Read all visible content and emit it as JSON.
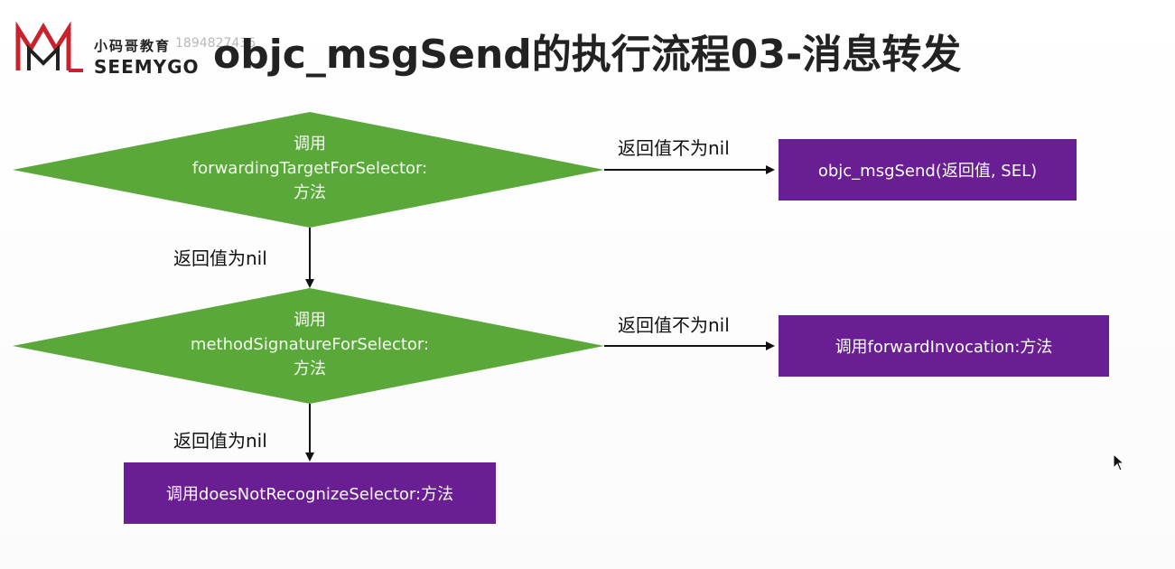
{
  "logo": {
    "chinese_text": "小码哥教育",
    "english_text": "SEEMYGO",
    "watermark": "1894827436"
  },
  "title": "objc_msgSend的执行流程03-消息转发",
  "diagram": {
    "decisions": [
      {
        "line1": "调用",
        "line2": "forwardingTargetForSelector:",
        "line3": "方法"
      },
      {
        "line1": "调用",
        "line2": "methodSignatureForSelector:",
        "line3": "方法"
      }
    ],
    "boxes": {
      "msgsend": "objc_msgSend(返回值, SEL)",
      "forward_invocation": "调用forwardInvocation:方法",
      "does_not_recognize": "调用doesNotRecognizeSelector:方法"
    },
    "edge_labels": {
      "not_nil_1": "返回值不为nil",
      "is_nil_1": "返回值为nil",
      "not_nil_2": "返回值不为nil",
      "is_nil_2": "返回值为nil"
    }
  },
  "colors": {
    "decision_fill": "#5aa83a",
    "box_fill": "#6a1e93",
    "arrow": "#111111"
  }
}
